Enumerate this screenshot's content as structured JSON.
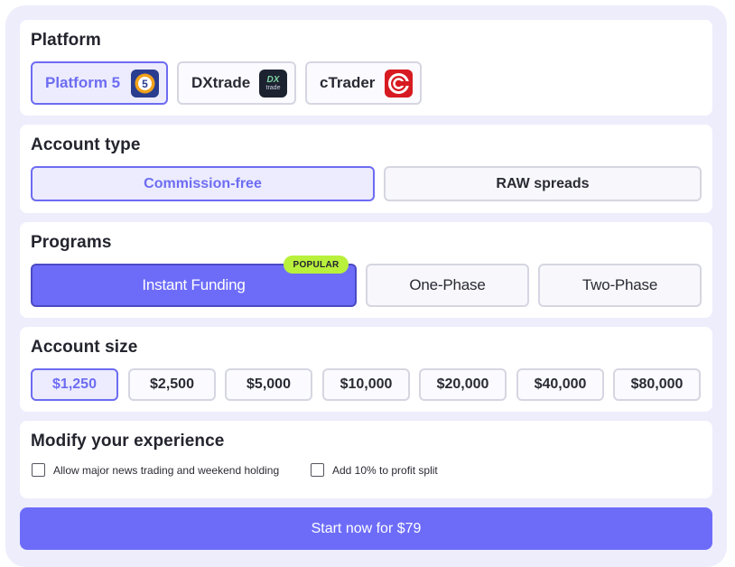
{
  "platform": {
    "title": "Platform",
    "options": [
      {
        "label": "Platform 5",
        "logo": "platform5-logo",
        "logo_text": "5"
      },
      {
        "label": "DXtrade",
        "logo": "dxtrade-logo",
        "logo_text_1": "DX",
        "logo_text_2": "trade"
      },
      {
        "label": "cTrader",
        "logo": "ctrader-logo"
      }
    ],
    "selected": "Platform 5"
  },
  "account_type": {
    "title": "Account type",
    "options": [
      "Commission-free",
      "RAW spreads"
    ],
    "selected": "Commission-free"
  },
  "programs": {
    "title": "Programs",
    "options": [
      "Instant Funding",
      "One-Phase",
      "Two-Phase"
    ],
    "selected": "Instant Funding",
    "badge": "POPULAR"
  },
  "account_size": {
    "title": "Account size",
    "options": [
      "$1,250",
      "$2,500",
      "$5,000",
      "$10,000",
      "$20,000",
      "$40,000",
      "$80,000"
    ],
    "selected": "$1,250"
  },
  "modify": {
    "title": "Modify your experience",
    "options": [
      {
        "label": "Allow major news trading and weekend holding",
        "checked": false
      },
      {
        "label": "Add 10% to profit split",
        "checked": false
      }
    ]
  },
  "cta": {
    "label": "Start now for $79"
  },
  "colors": {
    "accent": "#6d6cf9",
    "badge": "#b8f03c",
    "panel": "#ededfc"
  }
}
